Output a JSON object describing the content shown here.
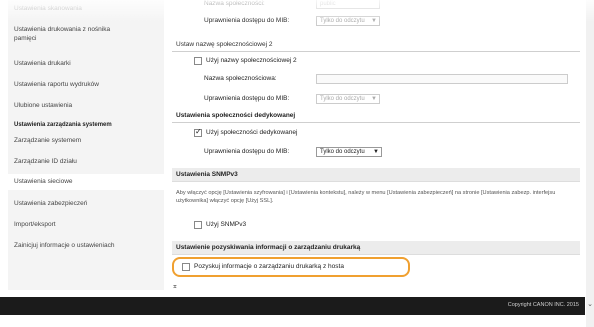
{
  "sidebar": {
    "items": [
      {
        "label": "Ustawienia skanowania"
      },
      {
        "label": "Ustawienia drukowania z nośnika"
      },
      {
        "label": "pamięci"
      },
      {
        "label": "Ustawienia drukarki"
      },
      {
        "label": "Ustawienia raportu wydruków"
      },
      {
        "label": "Ulubione ustawienia"
      }
    ],
    "section_header": "Ustawienia zarządzania systemem",
    "items2": [
      {
        "label": "Zarządzanie systemem"
      },
      {
        "label": "Zarządzanie ID działu"
      },
      {
        "label": "Ustawienia sieciowe"
      },
      {
        "label": "Ustawienia zabezpieczeń"
      },
      {
        "label": "Import/eksport"
      },
      {
        "label": "Zainicjuj informacje o ustawieniach"
      }
    ]
  },
  "main": {
    "top_faded_label": "Nazwa społeczności:",
    "top_faded_value": "public",
    "top_access_label": "Uprawnienia dostępu do MIB:",
    "top_access_value": "Tylko do odczytu",
    "community2_header": "Ustaw nazwę społecznościowej 2",
    "community2_check": "Użyj nazwy społecznościowej 2",
    "community2_name_label": "Nazwa społecznościowa:",
    "community2_access_label": "Uprawnienia dostępu do MIB:",
    "community2_access_value": "Tylko do odczytu",
    "dedicated_header": "Ustawienia społeczności dedykowanej",
    "dedicated_check": "Użyj społeczności dedykowanej",
    "dedicated_access_label": "Uprawnienia dostępu do MIB:",
    "dedicated_access_value": "Tylko do odczytu",
    "snmpv3_header": "Ustawienia SNMPv3",
    "snmpv3_desc": "Aby włączyć opcję [Ustawienia szyfrowania] i [Ustawienia kontekstu], należy w menu [Ustawienia zabezpieczeń] na stronie [Ustawienia zabezp. interfejsu użytkownika] włączyć opcję [Użyj SSL].",
    "snmpv3_check": "Użyj SNMPv3",
    "printer_mgmt_header": "Ustawienie pozyskiwania informacji o zarządzaniu drukarką",
    "printer_mgmt_check": "Pozyskuj informacje o zarządzaniu drukarką z hosta"
  },
  "footer": {
    "copyright": "Copyright CANON INC. 2015"
  },
  "colors": {
    "highlight": "#f0a030",
    "footer_bg": "#1b1b1b",
    "section_bg": "#ececec"
  }
}
